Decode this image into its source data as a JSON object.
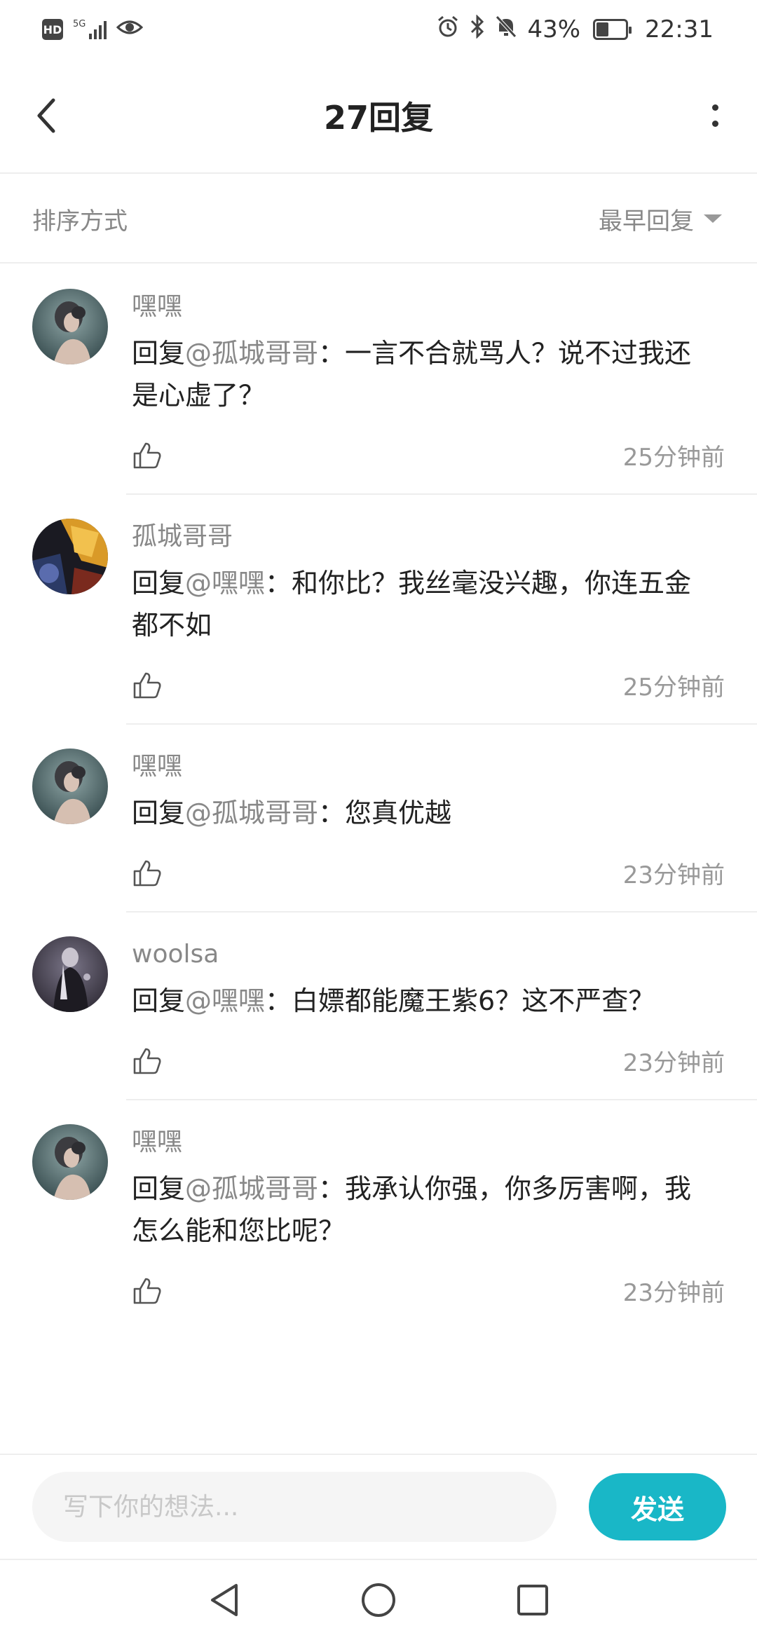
{
  "status_bar": {
    "hd": "HD",
    "network": "5G",
    "battery": "43%",
    "battery_level": 0.43,
    "time": "22:31"
  },
  "header": {
    "title": "27回复"
  },
  "sort": {
    "label": "排序方式",
    "value": "最早回复"
  },
  "replies": [
    {
      "name": "嘿嘿",
      "prefix": "回复",
      "mention": "@孤城哥哥",
      "text": "：一言不合就骂人？说不过我还是心虚了？",
      "time": "25分钟前",
      "avatar": "portrait-woman-avatar"
    },
    {
      "name": "孤城哥哥",
      "prefix": "回复",
      "mention": "@嘿嘿",
      "text": "：和你比？我丝毫没兴趣，你连五金都不如",
      "time": "25分钟前",
      "avatar": "game-art-avatar"
    },
    {
      "name": "嘿嘿",
      "prefix": "回复",
      "mention": "@孤城哥哥",
      "text": "：您真优越",
      "time": "23分钟前",
      "avatar": "portrait-woman-avatar"
    },
    {
      "name": "woolsa",
      "prefix": "回复",
      "mention": "@嘿嘿",
      "text": "：白嫖都能魔王紫6？这不严查？",
      "time": "23分钟前",
      "avatar": "dark-character-avatar"
    },
    {
      "name": "嘿嘿",
      "prefix": "回复",
      "mention": "@孤城哥哥",
      "text": "：我承认你强，你多厉害啊，我怎么能和您比呢？",
      "time": "23分钟前",
      "avatar": "portrait-woman-avatar"
    }
  ],
  "composer": {
    "placeholder": "写下你的想法...",
    "send_label": "发送"
  },
  "colors": {
    "accent": "#19b7c7"
  }
}
